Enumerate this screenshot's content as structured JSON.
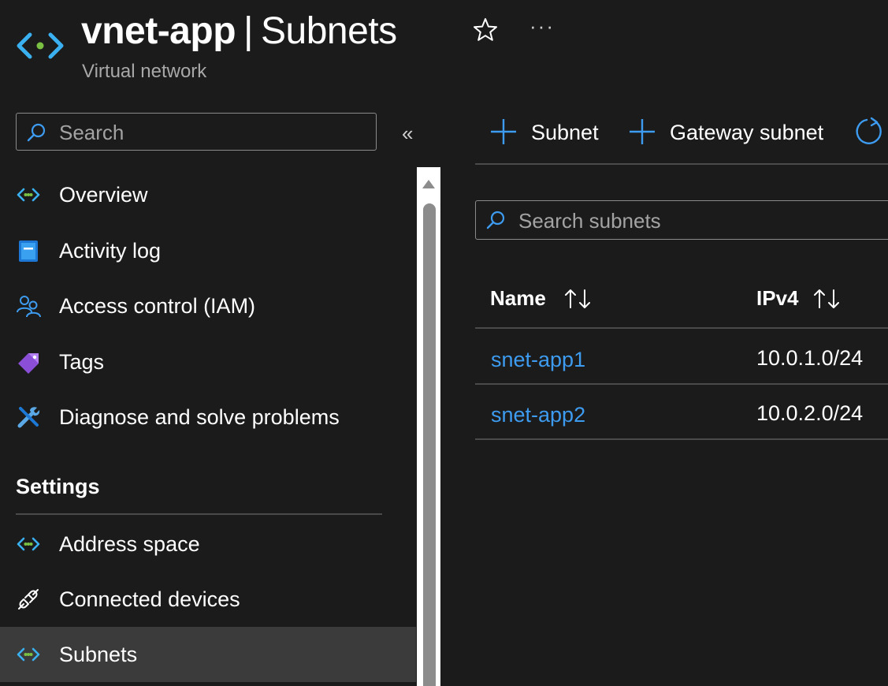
{
  "header": {
    "resource_name": "vnet-app",
    "separator": "|",
    "page_title": "Subnets",
    "subtitle": "Virtual network",
    "more_label": "···"
  },
  "sidebar": {
    "search_placeholder": "Search",
    "collapse_label": "«",
    "items": [
      {
        "label": "Overview",
        "icon": "vnet-icon"
      },
      {
        "label": "Activity log",
        "icon": "activity-log-icon"
      },
      {
        "label": "Access control (IAM)",
        "icon": "people-icon"
      },
      {
        "label": "Tags",
        "icon": "tag-icon"
      },
      {
        "label": "Diagnose and solve problems",
        "icon": "wrench-icon"
      }
    ],
    "settings_heading": "Settings",
    "settings_items": [
      {
        "label": "Address space",
        "icon": "vnet-icon"
      },
      {
        "label": "Connected devices",
        "icon": "plug-icon"
      },
      {
        "label": "Subnets",
        "icon": "vnet-icon",
        "selected": true
      }
    ]
  },
  "toolbar": {
    "add_subnet_label": "Subnet",
    "add_gateway_label": "Gateway subnet"
  },
  "main": {
    "search_placeholder": "Search subnets",
    "columns": [
      "Name",
      "IPv4"
    ],
    "rows": [
      {
        "name": "snet-app1",
        "ipv4": "10.0.1.0/24"
      },
      {
        "name": "snet-app2",
        "ipv4": "10.0.2.0/24"
      }
    ]
  },
  "colors": {
    "background": "#1b1b1b",
    "accent": "#3d9bf0",
    "selected_bg": "#3b3b3b",
    "muted_text": "#a8a8a8"
  }
}
